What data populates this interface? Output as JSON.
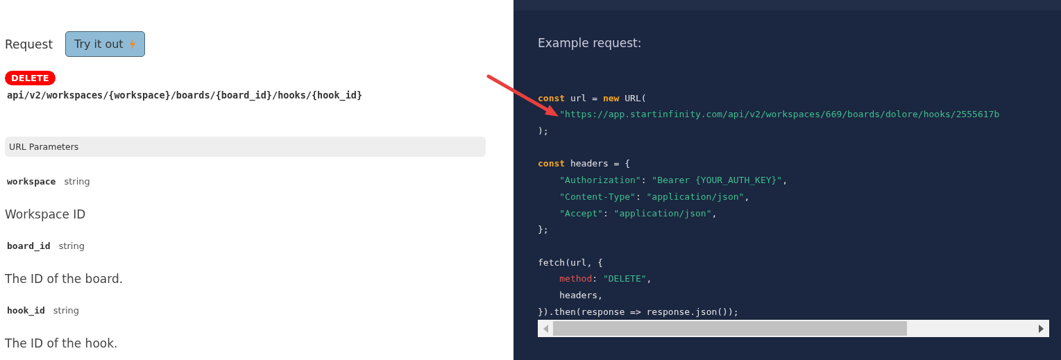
{
  "request": {
    "label": "Request",
    "try_button": "Try it out",
    "method": "DELETE",
    "path": "api/v2/workspaces/{workspace}/boards/{board_id}/hooks/{hook_id}"
  },
  "url_parameters": {
    "heading": "URL Parameters",
    "params": [
      {
        "name": "workspace",
        "type": "string",
        "description": "Workspace ID"
      },
      {
        "name": "board_id",
        "type": "string",
        "description": "The ID of the board."
      },
      {
        "name": "hook_id",
        "type": "string",
        "description": "The ID of the hook."
      }
    ]
  },
  "example": {
    "heading": "Example request:",
    "code_lines": [
      {
        "kind": "blank"
      },
      {
        "kind": "code",
        "tokens": [
          {
            "kind": "keyword",
            "text": "const"
          },
          {
            "kind": "plain",
            "text": " url = "
          },
          {
            "kind": "keyword",
            "text": "new"
          },
          {
            "kind": "plain",
            "text": " URL("
          }
        ]
      },
      {
        "kind": "code",
        "indent": true,
        "tokens": [
          {
            "kind": "string",
            "text": "\"https://app.startinfinity.com/api/v2/workspaces/669/boards/dolore/hooks/2555617b"
          }
        ]
      },
      {
        "kind": "code",
        "tokens": [
          {
            "kind": "plain",
            "text": ");"
          }
        ]
      },
      {
        "kind": "blank"
      },
      {
        "kind": "code",
        "tokens": [
          {
            "kind": "keyword",
            "text": "const"
          },
          {
            "kind": "plain",
            "text": " headers = {"
          }
        ]
      },
      {
        "kind": "code",
        "indent": true,
        "tokens": [
          {
            "kind": "string",
            "text": "\"Authorization\""
          },
          {
            "kind": "plain",
            "text": ": "
          },
          {
            "kind": "string",
            "text": "\"Bearer {YOUR_AUTH_KEY}\""
          },
          {
            "kind": "plain",
            "text": ","
          }
        ]
      },
      {
        "kind": "code",
        "indent": true,
        "tokens": [
          {
            "kind": "string",
            "text": "\"Content-Type\""
          },
          {
            "kind": "plain",
            "text": ": "
          },
          {
            "kind": "string",
            "text": "\"application/json\""
          },
          {
            "kind": "plain",
            "text": ","
          }
        ]
      },
      {
        "kind": "code",
        "indent": true,
        "tokens": [
          {
            "kind": "string",
            "text": "\"Accept\""
          },
          {
            "kind": "plain",
            "text": ": "
          },
          {
            "kind": "string",
            "text": "\"application/json\""
          },
          {
            "kind": "plain",
            "text": ","
          }
        ]
      },
      {
        "kind": "code",
        "tokens": [
          {
            "kind": "plain",
            "text": "};"
          }
        ]
      },
      {
        "kind": "blank"
      },
      {
        "kind": "code",
        "tokens": [
          {
            "kind": "plain",
            "text": "fetch(url, {"
          }
        ]
      },
      {
        "kind": "code",
        "indent": true,
        "tokens": [
          {
            "kind": "prop",
            "text": "method"
          },
          {
            "kind": "plain",
            "text": ": "
          },
          {
            "kind": "string",
            "text": "\"DELETE\""
          },
          {
            "kind": "plain",
            "text": ","
          }
        ]
      },
      {
        "kind": "code",
        "indent": true,
        "tokens": [
          {
            "kind": "plain",
            "text": "headers,"
          }
        ]
      },
      {
        "kind": "code",
        "tokens": [
          {
            "kind": "plain",
            "text": "}).then(response => response.json());"
          }
        ]
      }
    ]
  }
}
